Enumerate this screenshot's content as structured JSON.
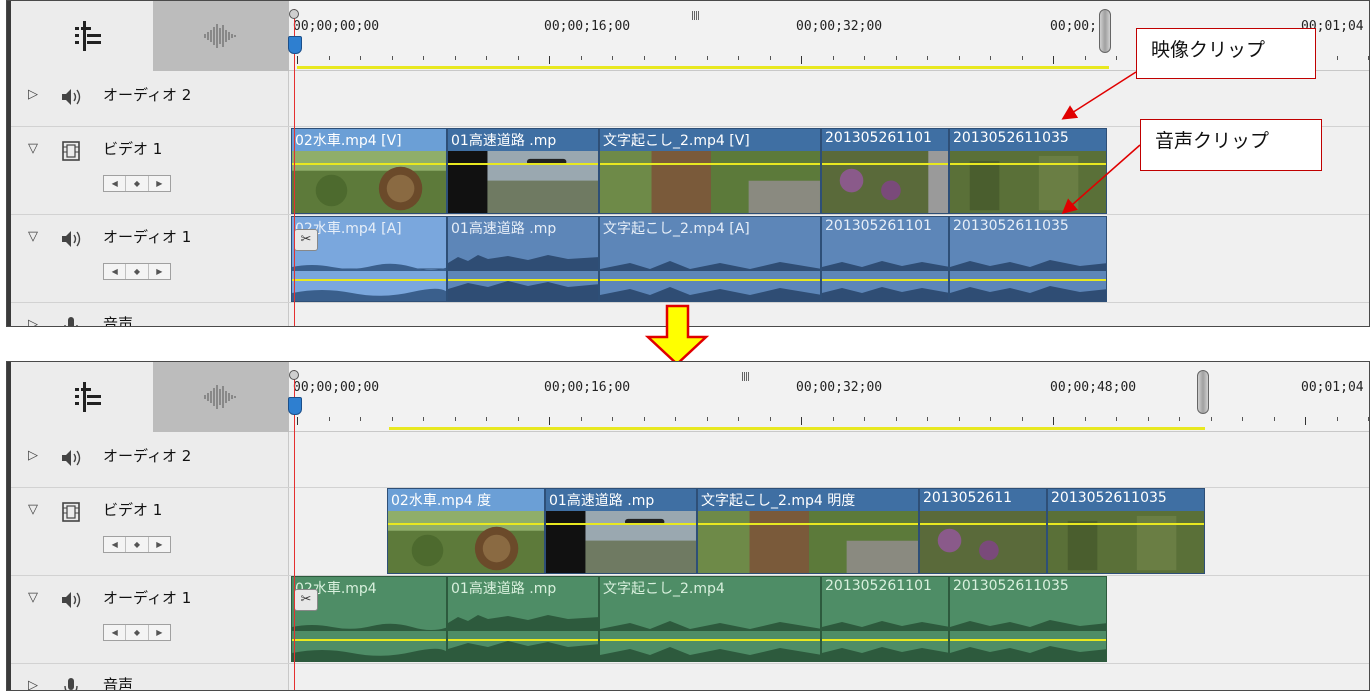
{
  "panels": [
    {
      "id": "before",
      "ruler": {
        "timecodes": [
          "00;00;00;00",
          "00;00;16;00",
          "00;00;32;00",
          "00;00;",
          "00;01;04"
        ]
      },
      "tracks": [
        {
          "name": "オーディオ 2",
          "type": "audio"
        },
        {
          "name": "ビデオ 1",
          "type": "video"
        },
        {
          "name": "オーディオ 1",
          "type": "audio"
        },
        {
          "name": "音声",
          "type": "narration"
        }
      ],
      "video_clips": [
        "02水車.mp4 [V]",
        "01高速道路 .mp",
        "文字起こし_2.mp4 [V]",
        "201305261101",
        "2013052611035"
      ],
      "audio_clips": [
        "02水車.mp4 [A]",
        "01高速道路 .mp",
        "文字起こし_2.mp4 [A]",
        "201305261101",
        "2013052611035"
      ]
    },
    {
      "id": "after",
      "ruler": {
        "timecodes": [
          "00;00;00;00",
          "00;00;16;00",
          "00;00;32;00",
          "00;00;48;00",
          "00;01;04"
        ]
      },
      "tracks": [
        {
          "name": "オーディオ 2",
          "type": "audio"
        },
        {
          "name": "ビデオ 1",
          "type": "video"
        },
        {
          "name": "オーディオ 1",
          "type": "audio"
        },
        {
          "name": "音声",
          "type": "narration"
        }
      ],
      "video_clips": [
        "02水車.mp4 度",
        "01高速道路 .mp",
        "文字起こし_2.mp4 明度",
        "2013052611",
        "2013052611035"
      ],
      "audio_clips": [
        "02水車.mp4",
        "01高速道路 .mp",
        "文字起こし_2.mp4",
        "201305261101",
        "2013052611035"
      ]
    }
  ],
  "callouts": {
    "video_clip": "映像クリップ",
    "audio_clip": "音声クリップ"
  },
  "colors": {
    "video_clip": "#3f6fa3",
    "audio_clip_before": "#5d86b8",
    "audio_clip_after": "#4e8d66",
    "playhead": "#e43030",
    "arrow": "#ffff00"
  }
}
